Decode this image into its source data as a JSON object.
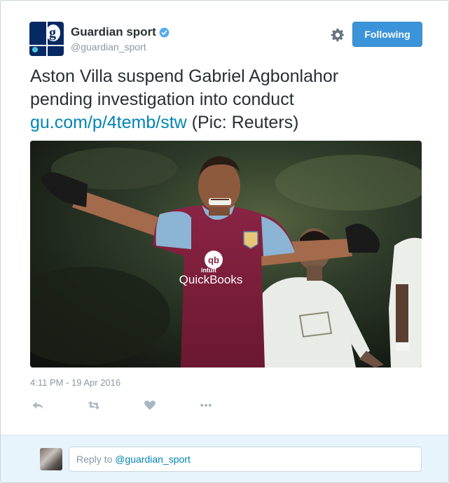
{
  "header": {
    "name": "Guardian sport",
    "handle": "@guardian_sport",
    "follow_label": "Following",
    "verified_icon": "verified-badge-icon",
    "avatar_letter": "g"
  },
  "tweet": {
    "text_line1": "Aston Villa suspend Gabriel Agbonlahor",
    "text_line2": "pending investigation into conduct",
    "link": "gu.com/p/4temb/stw",
    "link_suffix": " (Pic: Reuters)",
    "timestamp": "4:11 PM - 19 Apr 2016"
  },
  "photo": {
    "sponsor_top": "intuit",
    "sponsor_bottom": "QuickBooks",
    "sponsor_logo": "qb"
  },
  "actions": [
    "reply-icon",
    "retweet-icon",
    "like-icon",
    "more-icon"
  ],
  "reply": {
    "prefix": "Reply to ",
    "mention": "@guardian_sport"
  },
  "colors": {
    "accent": "#3b94d9",
    "link": "#0084b4",
    "reply_bar": "#e8f4fb",
    "claret": "#7a1f3a",
    "sky_blue": "#8cb4d4"
  }
}
